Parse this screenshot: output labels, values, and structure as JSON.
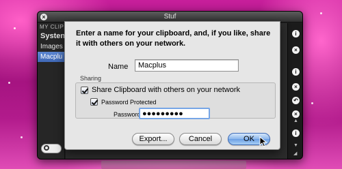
{
  "window": {
    "title": "Stuf"
  },
  "sidebar": {
    "header": "MY CLIPB",
    "items": [
      {
        "label": "Systen"
      },
      {
        "label": "Images"
      },
      {
        "label": "Macplu"
      }
    ]
  },
  "sheet": {
    "prompt": "Enter a name for your clipboard, and, if you like, share it with others on your network.",
    "name_label": "Name",
    "name_value": "Macplus",
    "sharing_caption": "Sharing",
    "share_label": "Share Clipboard with others on your network",
    "share_checked": true,
    "password_protected_label": "Password Protected",
    "password_protected_checked": true,
    "password_label": "Password",
    "password_value": "●●●●●●●●●",
    "buttons": {
      "export": "Export...",
      "cancel": "Cancel",
      "ok": "OK"
    }
  },
  "rightbar": {
    "icons": [
      {
        "name": "info-icon",
        "glyph": "i"
      },
      {
        "name": "close-icon",
        "glyph": "×"
      },
      {
        "name": "info-icon",
        "glyph": "i"
      },
      {
        "name": "close-icon",
        "glyph": "×"
      },
      {
        "name": "back-icon",
        "glyph": "↶"
      },
      {
        "name": "close-icon",
        "glyph": "×"
      },
      {
        "name": "info-icon",
        "glyph": "i"
      }
    ]
  },
  "colors": {
    "desktop": "#a8127f",
    "sheet_bg": "#e6e6e6",
    "selection": "#4a74c0",
    "default_button": "#7aaae8"
  }
}
